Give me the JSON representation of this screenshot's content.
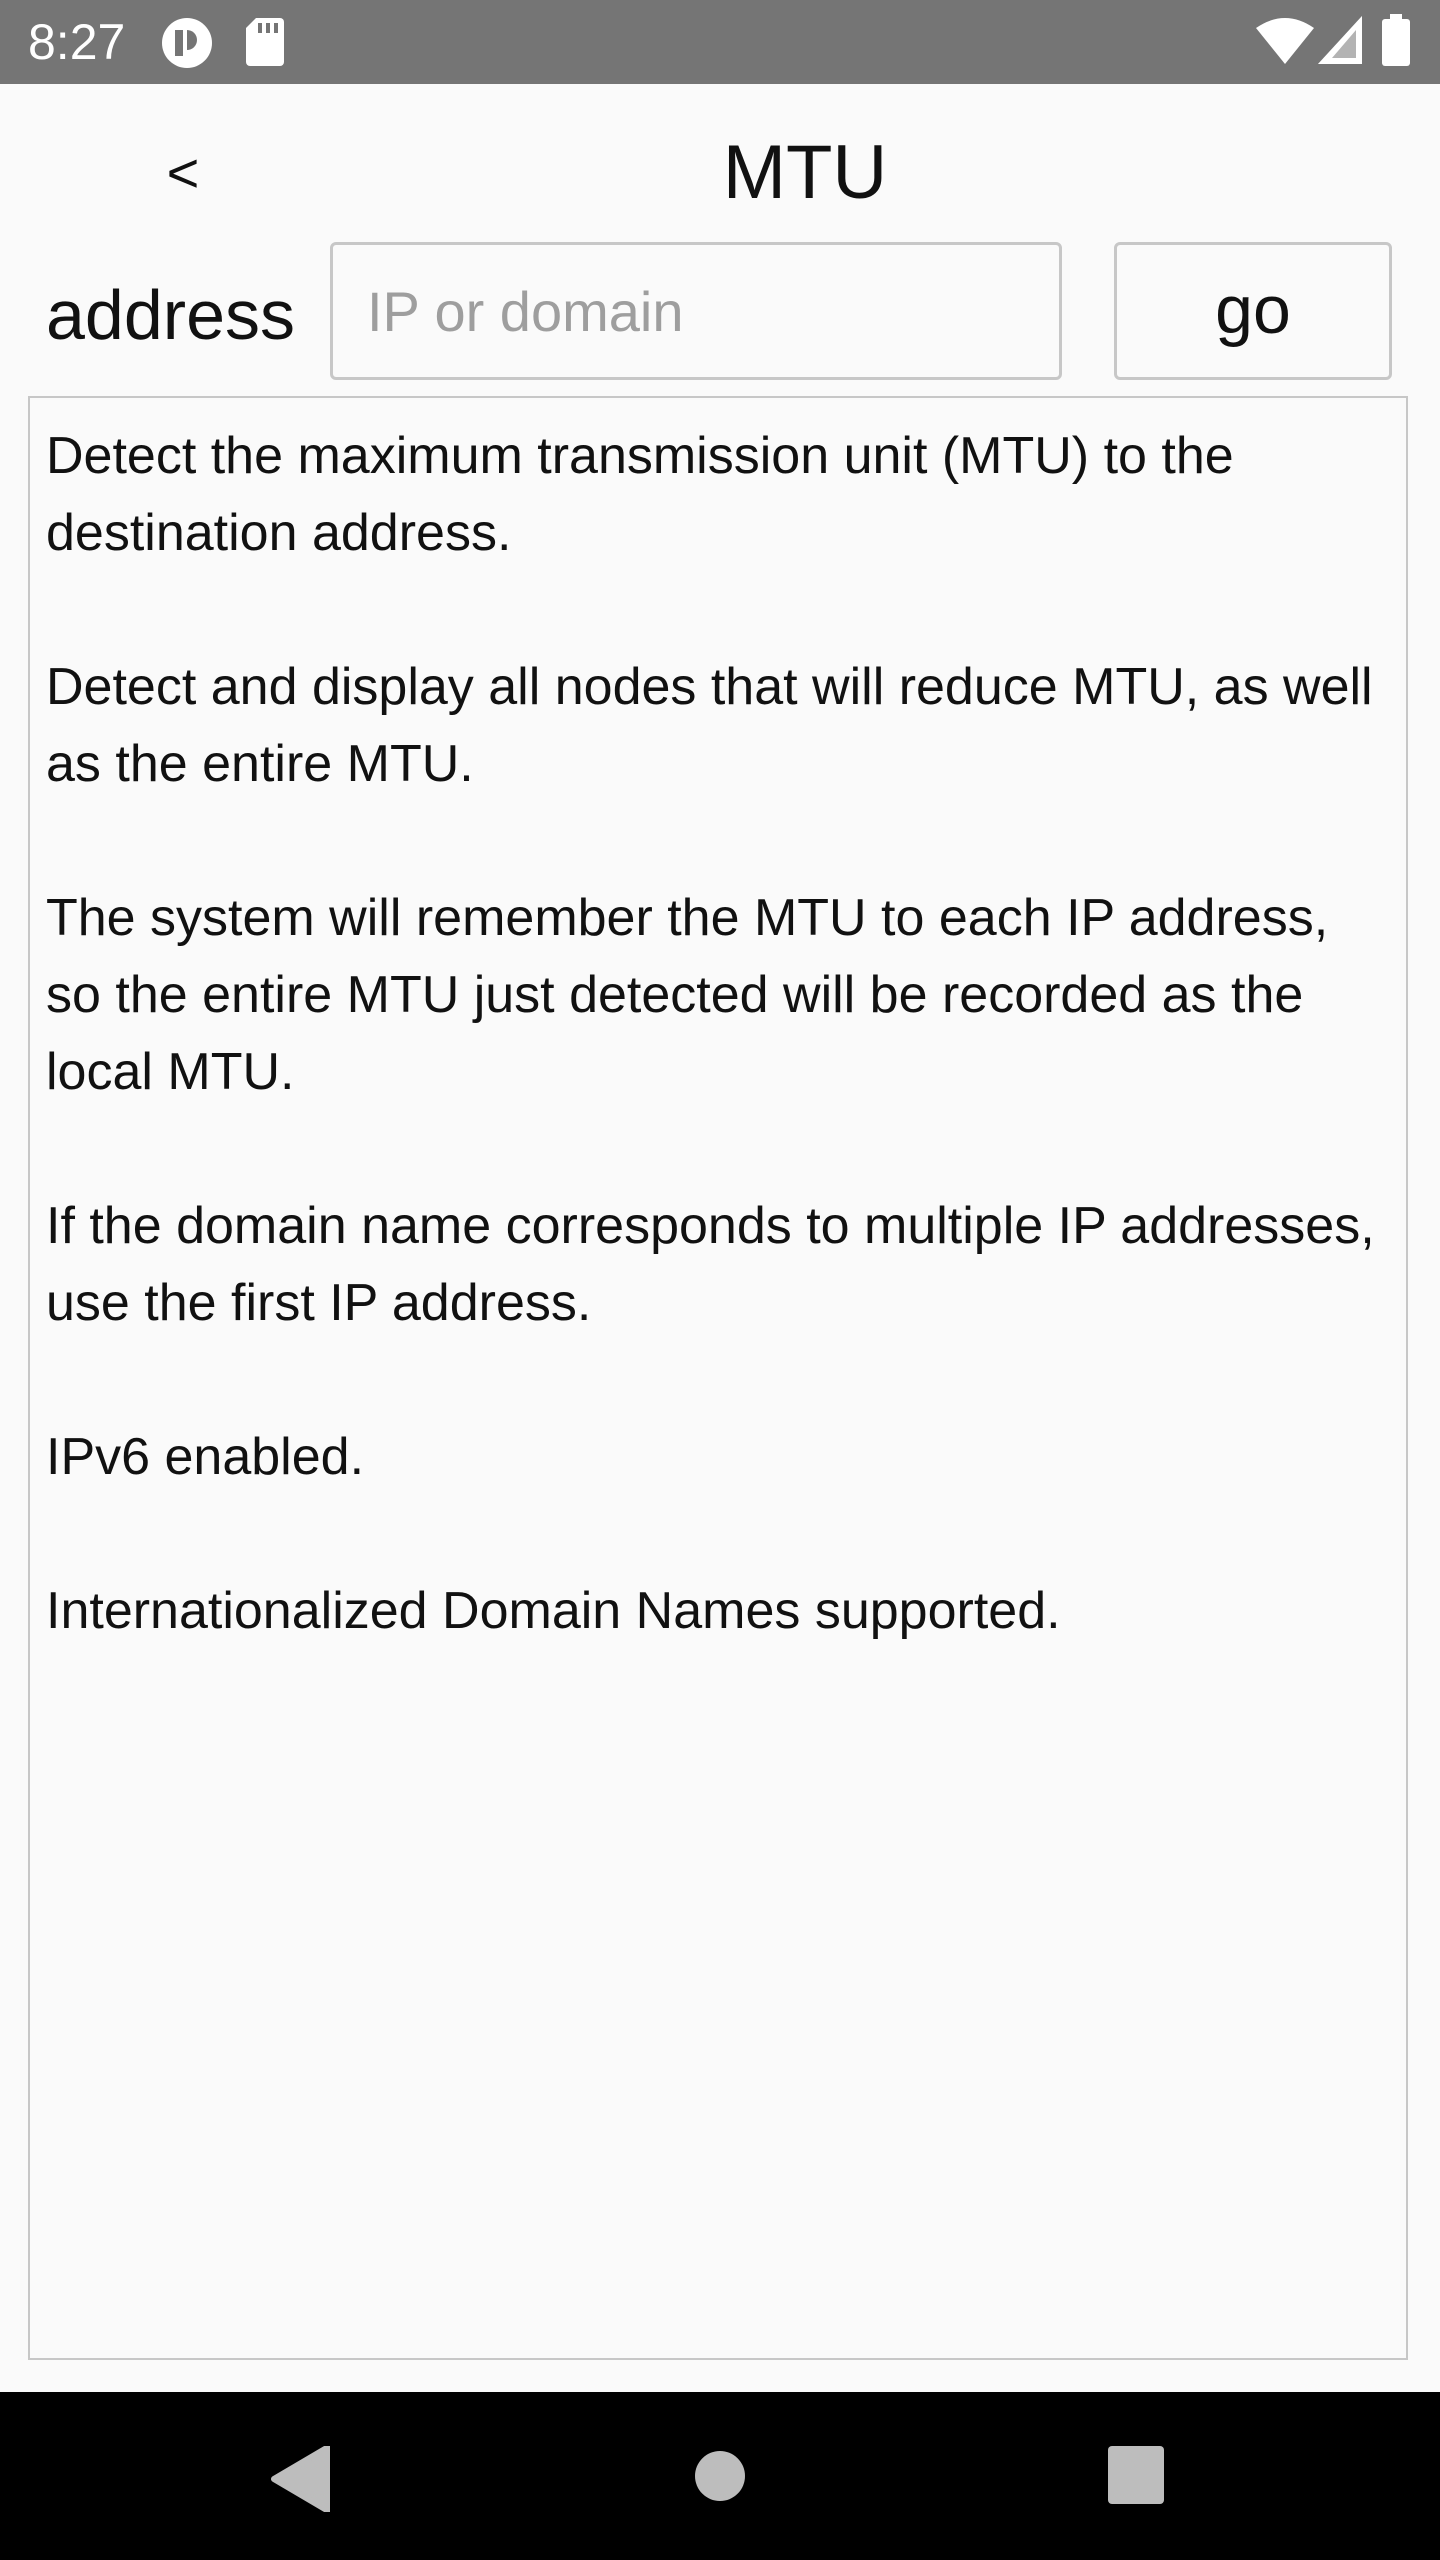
{
  "status_bar": {
    "time": "8:27",
    "icons": [
      "app-notification-icon",
      "sd-card-icon",
      "wifi-icon",
      "signal-icon",
      "battery-icon"
    ],
    "background": "#757575"
  },
  "header": {
    "back_label": "<",
    "title": "MTU"
  },
  "form": {
    "address_label": "address",
    "address_placeholder": "IP or domain",
    "address_value": "",
    "go_label": "go"
  },
  "info": {
    "paragraphs": [
      "Detect the maximum transmission unit (MTU) to the destination address.",
      "Detect and display all nodes that will reduce MTU, as well as the entire MTU.",
      "The system will remember the MTU to each IP address, so the entire MTU just detected will be recorded as the local MTU.",
      "If the domain name corresponds to multiple IP addresses, use the first IP address.",
      "IPv6 enabled.",
      "Internationalized Domain Names supported."
    ]
  },
  "nav_bar": {
    "icons": [
      "back-triangle-icon",
      "home-circle-icon",
      "recents-square-icon"
    ],
    "background": "#000000"
  }
}
